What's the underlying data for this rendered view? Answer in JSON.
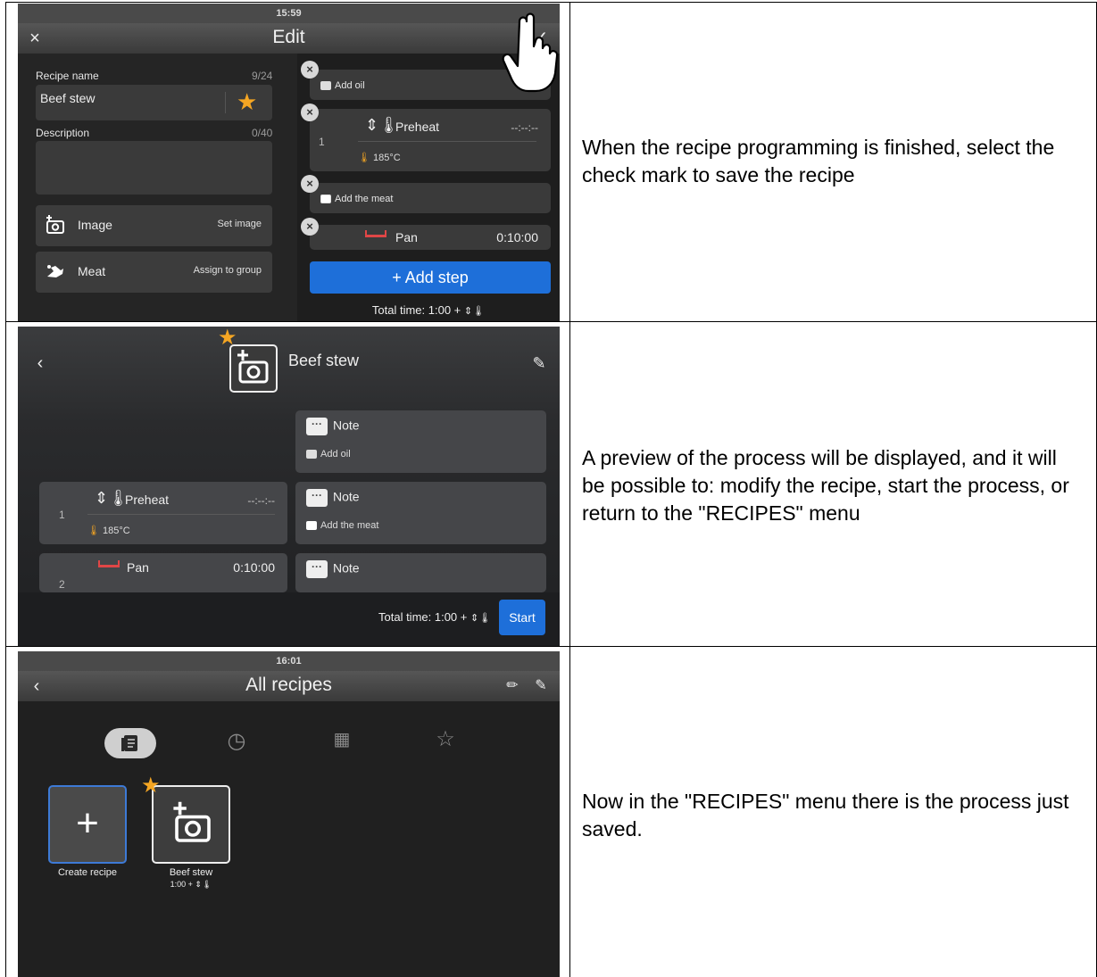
{
  "rows": [
    {
      "caption": "When the recipe programming is finished, select the check mark to save the recipe",
      "screen": {
        "time": "15:59",
        "title": "Edit",
        "recipe_name_label": "Recipe name",
        "recipe_name_count": "9/24",
        "recipe_name_value": "Beef stew",
        "description_label": "Description",
        "description_count": "0/40",
        "image_label": "Image",
        "image_action": "Set image",
        "group_label": "Meat",
        "group_action": "Assign to group",
        "steps": {
          "note1": "Add oil",
          "preheat_label": "Preheat",
          "preheat_time": "--:--:--",
          "preheat_index": "1",
          "preheat_temp": "185°C",
          "note2": "Add the meat",
          "pan_label": "Pan",
          "pan_time": "0:10:00"
        },
        "add_step": "+ Add step",
        "total_time": "Total time: 1:00 + "
      }
    },
    {
      "caption": "A preview of the process will be displayed, and it will be possible to: modify the recipe, start the process, or return to the \"RECIPES\" menu",
      "screen": {
        "recipe_title": "Beef stew",
        "note_label": "Note",
        "note1_sub": "Add oil",
        "preheat_label": "Preheat",
        "preheat_time": "--:--:--",
        "preheat_index": "1",
        "preheat_temp": "185°C",
        "note2_sub": "Add the meat",
        "pan_label": "Pan",
        "pan_time": "0:10:00",
        "pan_index": "2",
        "total_time": "Total time: 1:00 + ",
        "start": "Start"
      }
    },
    {
      "caption": "Now in the \"RECIPES\" menu there is the process just saved.",
      "screen": {
        "time": "16:01",
        "title": "All recipes",
        "create_recipe": "Create recipe",
        "recipe_name": "Beef stew",
        "recipe_time": "1:00 + "
      }
    }
  ],
  "colors": {
    "accent_blue": "#1e6fd9",
    "star": "#f5a623"
  }
}
